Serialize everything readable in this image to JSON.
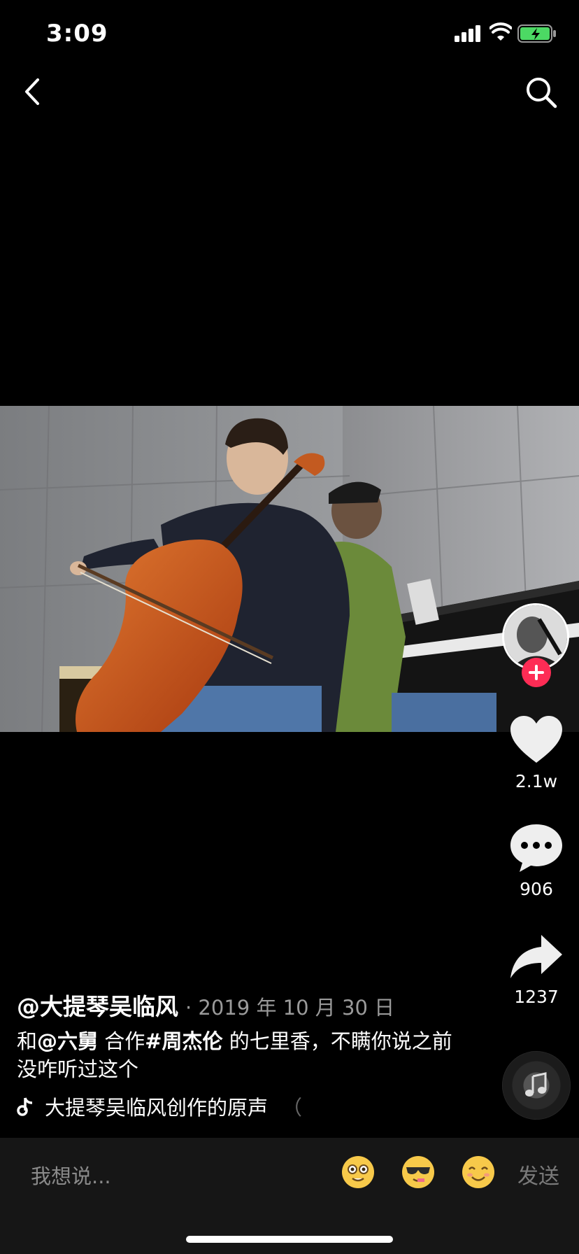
{
  "status_bar": {
    "time": "3:09"
  },
  "post": {
    "author": "@大提琴吴临风",
    "date": "· 2019 年 10 月 30 日",
    "caption_parts": [
      "和",
      "@六舅",
      " 合作",
      "#周杰伦",
      " 的七里香，不瞒你说之前没咋听过这个"
    ],
    "sound": "大提琴吴临风创作的原声",
    "sound_fade": "（"
  },
  "stats": {
    "likes": "2.1w",
    "comments": "906",
    "shares": "1237"
  },
  "comment_bar": {
    "placeholder": "我想说...",
    "send_label": "发送"
  },
  "colors": {
    "accent": "#fe2c55",
    "background": "#000000"
  },
  "icons": [
    "back-icon",
    "search-icon",
    "heart-icon",
    "comment-icon",
    "share-icon",
    "music-note-icon",
    "plus-icon"
  ]
}
